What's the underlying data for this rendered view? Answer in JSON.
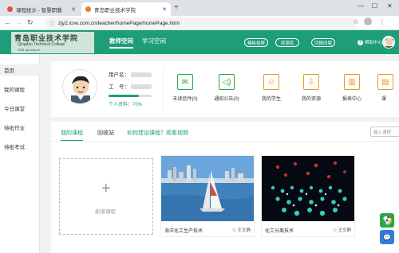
{
  "browser": {
    "tabs": [
      {
        "title": "课程统计 - 智慧职教"
      },
      {
        "title": "青岛职业技术学院"
      }
    ],
    "url": "zjy2.icve.com.cn/teacher/homePage/homePage.html"
  },
  "header": {
    "logo_cn": "青岛职业技术学院",
    "logo_en": "Qingdao Technical College",
    "logo_year": "1951   qtc.edu.cn",
    "nav": [
      "教师空间",
      "学习空间"
    ],
    "buttons": [
      "模板投屏",
      "资源库",
      "切换旧版"
    ],
    "help": "帮助中心",
    "help_icon": "?"
  },
  "sidebar": {
    "items": [
      {
        "label": "首页"
      },
      {
        "label": "我的课程"
      },
      {
        "label": "今日课堂"
      },
      {
        "label": "待批作业"
      },
      {
        "label": "待批考试"
      }
    ]
  },
  "profile": {
    "username_label": "用户名：",
    "job_id_label": "工　号：",
    "completeness_label": "个人资料：70%",
    "completeness_value": 0.7,
    "quick_links": [
      {
        "label": "未读信件(0)",
        "icon": "mail-icon",
        "color": "#27a845"
      },
      {
        "label": "通知公告(0)",
        "icon": "speaker-icon",
        "color": "#27a845"
      },
      {
        "label": "我的学生",
        "icon": "student-icon",
        "color": "#e49b26"
      },
      {
        "label": "我的资源",
        "icon": "resource-icon",
        "color": "#e49b26"
      },
      {
        "label": "报表中心",
        "icon": "report-icon",
        "color": "#e49b26"
      },
      {
        "label": "课",
        "icon": "course-icon",
        "color": "#e49b26"
      }
    ]
  },
  "courses": {
    "tabs": [
      "我的课程",
      "回收站"
    ],
    "link": "如何建设课程？观看视频",
    "search_placeholder": "输入课程",
    "new_course_label": "新增课程",
    "cards": [
      {
        "name": "海洋化工生产技术",
        "teacher": "王文静"
      },
      {
        "name": "化工分离技术",
        "teacher": "王文静"
      }
    ]
  },
  "colors": {
    "brand": "#1d9e78",
    "green_icon": "#27a845",
    "orange_icon": "#e49b26"
  }
}
